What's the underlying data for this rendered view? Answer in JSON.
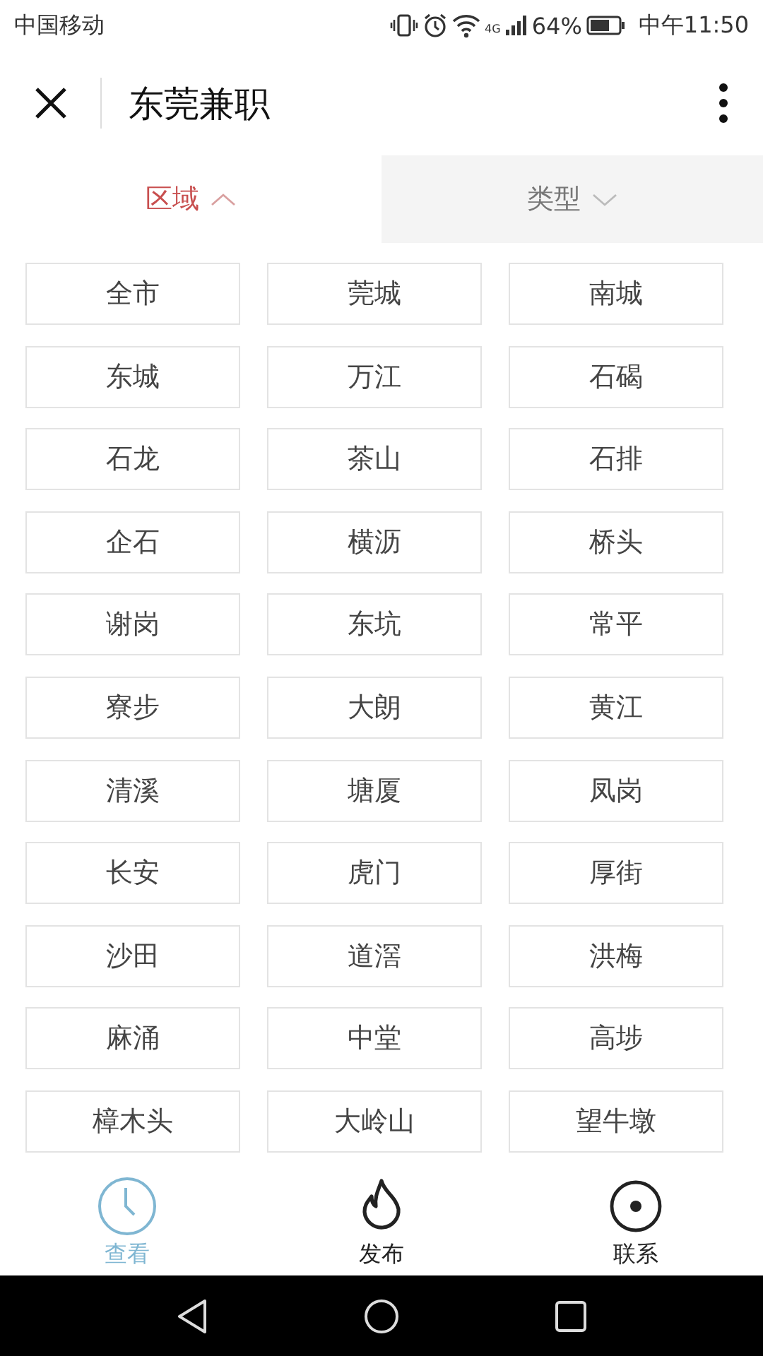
{
  "status_bar": {
    "carrier": "中国移动",
    "network": "4G",
    "battery": "64%",
    "time": "中午11:50"
  },
  "header": {
    "title": "东莞兼职"
  },
  "filter_tabs": [
    {
      "label": "区域",
      "selected": true
    },
    {
      "label": "类型",
      "selected": false
    }
  ],
  "areas": [
    "全市",
    "莞城",
    "南城",
    "东城",
    "万江",
    "石碣",
    "石龙",
    "茶山",
    "石排",
    "企石",
    "横沥",
    "桥头",
    "谢岗",
    "东坑",
    "常平",
    "寮步",
    "大朗",
    "黄江",
    "清溪",
    "塘厦",
    "凤岗",
    "长安",
    "虎门",
    "厚街",
    "沙田",
    "道滘",
    "洪梅",
    "麻涌",
    "中堂",
    "高埗",
    "樟木头",
    "大岭山",
    "望牛墩"
  ],
  "bottom_tabs": [
    {
      "label": "查看",
      "kind": "clock",
      "selected": true
    },
    {
      "label": "发布",
      "kind": "flame",
      "selected": false
    },
    {
      "label": "联系",
      "kind": "dot",
      "selected": false
    }
  ]
}
